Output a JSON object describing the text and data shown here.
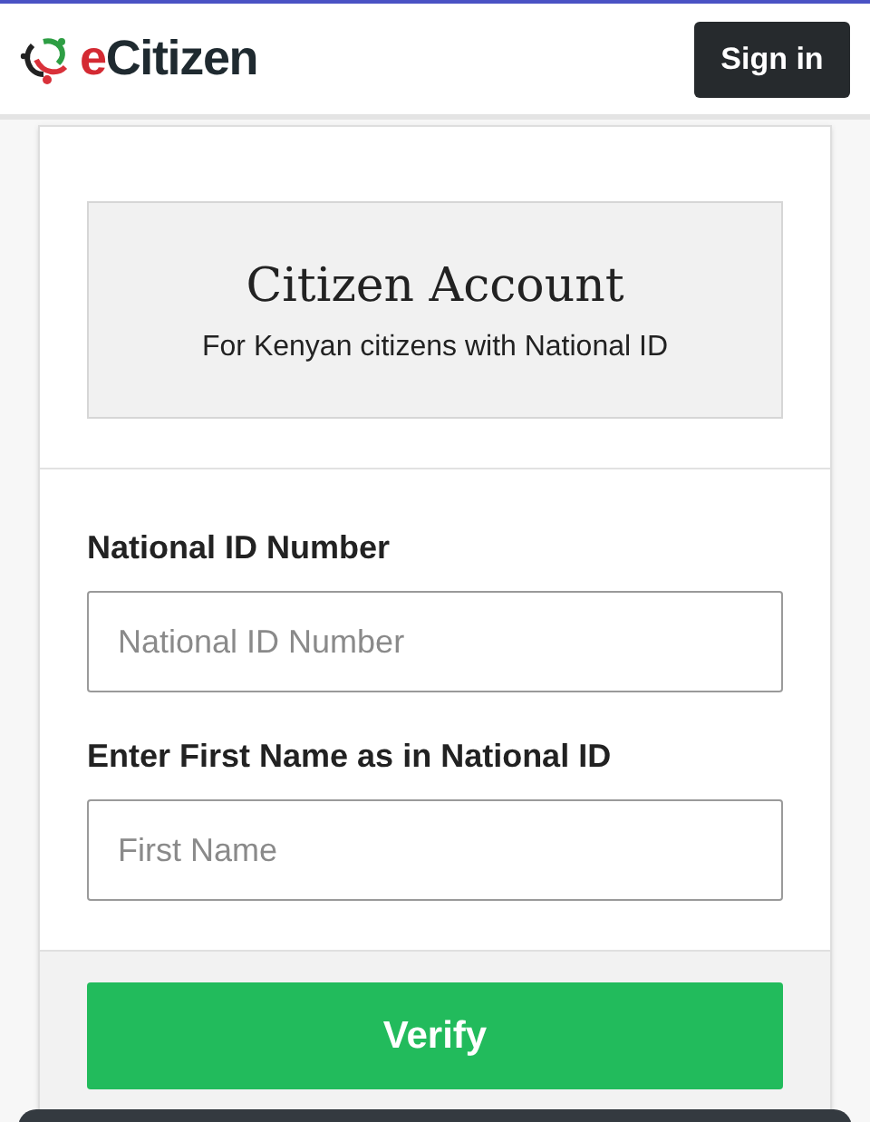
{
  "header": {
    "logo": {
      "accent": "e",
      "rest": "Citizen"
    },
    "sign_in": "Sign in"
  },
  "account": {
    "title": "Citizen Account",
    "subtitle": "For Kenyan citizens with National ID"
  },
  "fields": [
    {
      "label": "National ID Number",
      "placeholder": "National ID Number"
    },
    {
      "label": "Enter First Name as in National ID",
      "placeholder": "First Name"
    }
  ],
  "verify": "Verify"
}
